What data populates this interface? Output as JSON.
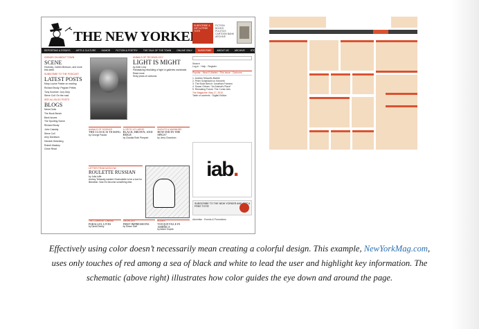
{
  "screenshot": {
    "logo": "THE NEW YORKER",
    "subscribe_ad": "Subscribe & get a free tote",
    "promo_items": [
      "FICTION",
      "BOOKS",
      "POLITICS",
      "CARTOON BANK",
      "ARCHIVE"
    ],
    "nav_items": [
      "Reporting & Essays",
      "Arts & Culture",
      "Humor",
      "Fiction & Poetry",
      "The Talk of the Town",
      "Online Only",
      "Subscribe",
      "About Us",
      "Archive",
      "Store"
    ],
    "left_column": {
      "kicker": "Goings On About Town",
      "scene_heading": "SCENE",
      "scene_text": "Hockney, Cartier-Bresson, and more this week",
      "subscribe_podcast": "Subscribe to the podcast",
      "latest_heading": "LATEST POSTS",
      "latest_items": [
        "Mary-Louise Parker on reading",
        "Richard Brody: Pegram Pettits",
        "Tony Kushner: Jury Duty",
        "Steve Coll: On the road"
      ],
      "see_all": "See all blog posts",
      "blogs_heading": "BLOGS",
      "blogs_items": [
        "News Desk",
        "The Book Bench",
        "Back Issues",
        "The Sporting Scene",
        "Richard Brody",
        "John Cassidy",
        "Steve Coll",
        "Amy Davidson",
        "Hendrik Hertzberg",
        "Robert Mackey",
        "Close Read"
      ]
    },
    "feature": {
      "kicker": "Annals of Technology",
      "title": "LIGHT IS MIGHT",
      "byline": "by Ariel Levy",
      "summary": "Painstaking rebuilding of light in galleries worldwide.",
      "read_more": "Read more",
      "see_also": "Sixty years of cartoons"
    },
    "right_column": {
      "search_label": "Search",
      "account_links": "Log in · Help · Register",
      "tabs": "Popular · Most E-Mailed · This Issue · Cartoons",
      "popular_items": [
        "1. Andrea Tetrault's Barbie",
        "2. Peter Schjeldahl on Kenneth",
        "3. The Book Bench: Jonathan Franzen",
        "4. Susan Orlean: \"An Animal's Place\"",
        "5. Remaking Future: The Comic Arts"
      ],
      "this_week_label": "The Magazine: May 17, 2010",
      "table_of_contents": "Table of contents · Digital Edition"
    },
    "ad_logo": "iab",
    "ad_banner": "SUBSCRIBE TO THE NEW YORKER AND GET A FREE TOTE!",
    "mid_grid": [
      {
        "kicker": "Annals of Science",
        "title": "THE CLOCK IS TICKING",
        "byline": "by George Packer"
      },
      {
        "kicker": "A Critic at Large",
        "title": "BLACK, BROWN, AND BEIGE",
        "byline": "by Claudia Roth Pierpont"
      },
      {
        "kicker": "Shouts & Murmurs",
        "title": "HOW DID IN THE SPIGS?",
        "byline": "by Jerry Chardonn"
      }
    ],
    "roulette": {
      "kicker": "Letter from Moscow",
      "title": "ROULETTE RUSSIAN",
      "byline": "by Julia Ioffe",
      "summary": "Andrey Tetravaly wanted Chatroulette to be a tool for liberation. Now it's become something else."
    },
    "bottom_grid": [
      {
        "kicker": "The Current Cinema",
        "title": "PARALLEL LIVES",
        "byline": "by David Denby"
      },
      {
        "kicker": "Shortlist",
        "title": "FIRST IMPRESSIONS",
        "byline": "by Simon Gaff"
      },
      {
        "kicker": "Books",
        "title": "TOCQUEVILLE IN AMERICA",
        "byline": "by Adam Gopnik"
      }
    ],
    "ad_footer": "Advertise · Events & Promotions"
  },
  "caption": {
    "before_link": "Effectively using color doesn’t necessarily mean creating a colorful design. This example, ",
    "link": "NewYorkMag.com",
    "after_link": ", uses only touches of red among a sea of black and white to lead the user and highlight key information. The schematic (above right) illustrates how color guides the eye down and around the page."
  },
  "colors": {
    "accent_red": "#d95230",
    "block_beige": "#f4dcc1",
    "bar_dark": "#3c3c3c",
    "link_blue": "#2a6fb0"
  }
}
